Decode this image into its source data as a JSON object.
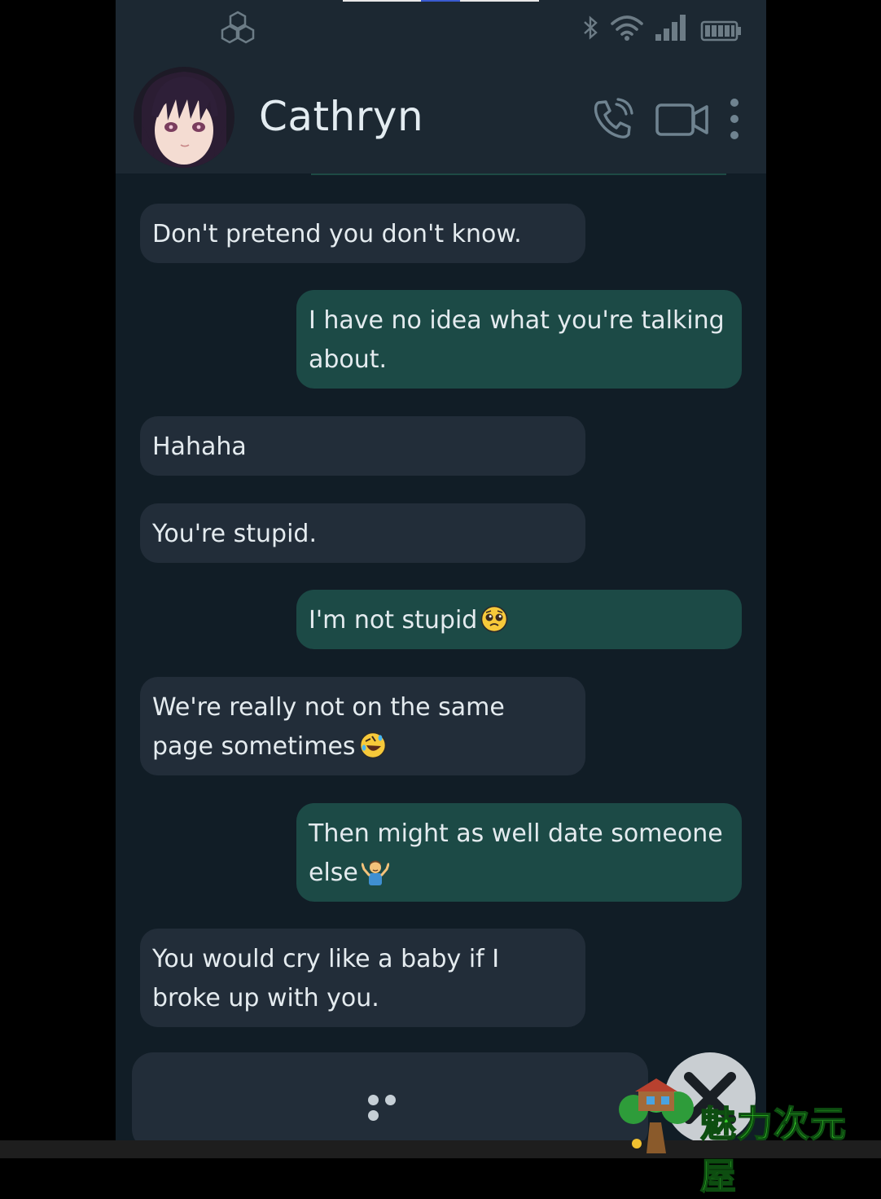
{
  "statusbar": {
    "icons": [
      "app-logo-icon",
      "bluetooth-icon",
      "wifi-icon",
      "cell-signal-icon",
      "battery-icon"
    ]
  },
  "header": {
    "contact_name": "Cathryn",
    "actions": [
      "phone-call-icon",
      "video-call-icon",
      "more-options-icon"
    ]
  },
  "messages": [
    {
      "side": "received",
      "text": "Don't pretend you don't know."
    },
    {
      "side": "sent",
      "text": "I have no idea what you're talking about."
    },
    {
      "side": "received",
      "text": "Hahaha"
    },
    {
      "side": "received",
      "text": "You're stupid."
    },
    {
      "side": "sent",
      "text": "I'm not stupid",
      "emoji": "pleading-face-emoji"
    },
    {
      "side": "received",
      "text": "We're really not on the same page sometimes",
      "emoji": "rolling-laughing-emoji"
    },
    {
      "side": "sent",
      "text": "Then might as well date someone else",
      "emoji": "person-shrugging-emoji"
    },
    {
      "side": "received",
      "text": "You would cry like a baby if I broke up with you."
    }
  ],
  "composer": {
    "indicator": "typing-dots"
  },
  "watermark": {
    "text": "魅力次元屋"
  },
  "colors": {
    "background": "#111d26",
    "header": "#1c2832",
    "received_bubble": "#222d39",
    "sent_bubble": "#1c4a46",
    "text": "#e4ebef",
    "watermark": "#39d12c"
  }
}
